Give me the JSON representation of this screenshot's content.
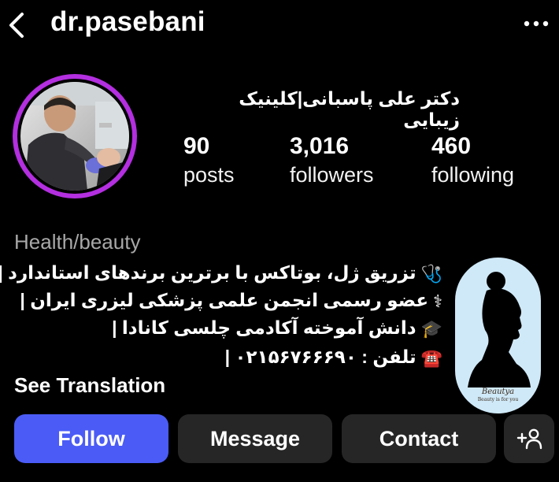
{
  "header": {
    "username": "dr.pasebani"
  },
  "profile": {
    "display_name": "دکتر علی پاسبانی|کلینیک زیبایی",
    "stats": [
      {
        "value": "90",
        "label": "posts"
      },
      {
        "value": "3,016",
        "label": "followers"
      },
      {
        "value": "460",
        "label": "following"
      }
    ],
    "category": "Health/beauty",
    "bio": [
      {
        "emoji": "🩺",
        "text": "تزریق ژل، بوتاکس با برترین برندهای استاندارد |"
      },
      {
        "emoji": "⚕",
        "text": "عضو رسمی انجمن علمی پزشکی لیزری ایران |"
      },
      {
        "emoji": "🎓",
        "text": "دانش آموخته آکادمی چلسی کانادا |"
      },
      {
        "emoji": "☎️",
        "text": "تلفن : ۰۲۱۵۶۷۶۶۶۹۰ |"
      }
    ],
    "see_translation": "See Translation"
  },
  "highlight": {
    "title": "Beautya",
    "subtitle": "Beauty is for you"
  },
  "actions": {
    "follow": "Follow",
    "message": "Message",
    "contact": "Contact"
  },
  "icons": {
    "back": "chevron-left-icon",
    "more": "more-horizontal-icon",
    "add_person": "add-person-icon"
  },
  "colors": {
    "follow_button": "#4a5cf5",
    "story_ring": "#b32fe0",
    "secondary_button": "#262626"
  }
}
